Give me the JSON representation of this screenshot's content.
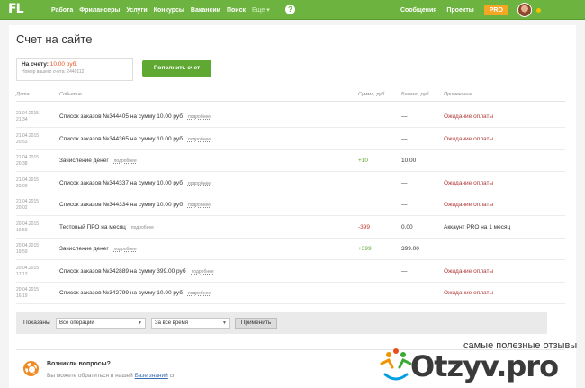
{
  "topbar": {
    "logo": "FL",
    "nav": [
      "Работа",
      "Фрилансеры",
      "Услуги",
      "Конкурсы",
      "Вакансии",
      "Поиск"
    ],
    "more": "Еще",
    "help": "?",
    "messages": "Сообщения",
    "projects": "Проекты",
    "pro": "PRO"
  },
  "page": {
    "title": "Счет на сайте"
  },
  "account": {
    "label": "На счету:",
    "amount": "10.00 руб.",
    "number": "Номер вашего счета: 2440112",
    "fund_button": "Пополнить счет"
  },
  "table": {
    "headers": {
      "date": "Дата",
      "event": "Событие",
      "sum": "Сумма, руб.",
      "balance": "Баланс, руб.",
      "note": "Примечание"
    },
    "more_label": "подробнее",
    "rows": [
      {
        "date": "21.04.2015",
        "time": "21:34",
        "event": "Список заказов №344405 на сумму 10.00 руб",
        "sum": "",
        "sum_type": "",
        "balance": "—",
        "note": "Ожидание оплаты",
        "note_type": "wait"
      },
      {
        "date": "21.04.2015",
        "time": "20:53",
        "event": "Список заказов №344365 на сумму 10.00 руб",
        "sum": "",
        "sum_type": "",
        "balance": "—",
        "note": "Ожидание оплаты",
        "note_type": "wait"
      },
      {
        "date": "21.04.2015",
        "time": "20:38",
        "event": "Зачисление денег",
        "sum": "+10",
        "sum_type": "plus",
        "balance": "10.00",
        "note": "",
        "note_type": ""
      },
      {
        "date": "21.04.2015",
        "time": "20:09",
        "event": "Список заказов №344337 на сумму 10.00 руб",
        "sum": "",
        "sum_type": "",
        "balance": "—",
        "note": "Ожидание оплаты",
        "note_type": "wait"
      },
      {
        "date": "21.04.2015",
        "time": "20:02",
        "event": "Список заказов №344334 на сумму 10.00 руб",
        "sum": "",
        "sum_type": "",
        "balance": "—",
        "note": "Ожидание оплаты",
        "note_type": "wait"
      },
      {
        "date": "20.04.2015",
        "time": "19:59",
        "event": "Тестовый ПРО на месяц",
        "sum": "-399",
        "sum_type": "minus",
        "balance": "0.00",
        "note": "Аккаунт PRO на 1 месяц",
        "note_type": "ok"
      },
      {
        "date": "20.04.2015",
        "time": "19:59",
        "event": "Зачисление денег",
        "sum": "+399",
        "sum_type": "plus",
        "balance": "399.00",
        "note": "",
        "note_type": ""
      },
      {
        "date": "20.04.2015",
        "time": "17:12",
        "event": "Список заказов №342889 на сумму 399.00 руб",
        "sum": "",
        "sum_type": "",
        "balance": "—",
        "note": "Ожидание оплаты",
        "note_type": "wait"
      },
      {
        "date": "20.04.2015",
        "time": "16:19",
        "event": "Список заказов №342799 на сумму 10.00 руб",
        "sum": "",
        "sum_type": "",
        "balance": "—",
        "note": "Ожидание оплаты",
        "note_type": "wait"
      }
    ]
  },
  "filter": {
    "label": "Показаны",
    "operations": "Все операции",
    "period": "За все время",
    "apply": "Применить"
  },
  "help": {
    "title": "Возникли вопросы?",
    "text": "Вы можете обратиться в нашей",
    "link": "Базе знаний",
    "link_suffix": "cr"
  },
  "watermark": {
    "tagline": "самые полезные отзывы",
    "brand": "Otzyv.pro"
  },
  "colors": {
    "topbar": "#6db33f",
    "button": "#5fa832",
    "pending": "#b03a3a",
    "plus": "#5fa832",
    "minus": "#c0392b"
  }
}
